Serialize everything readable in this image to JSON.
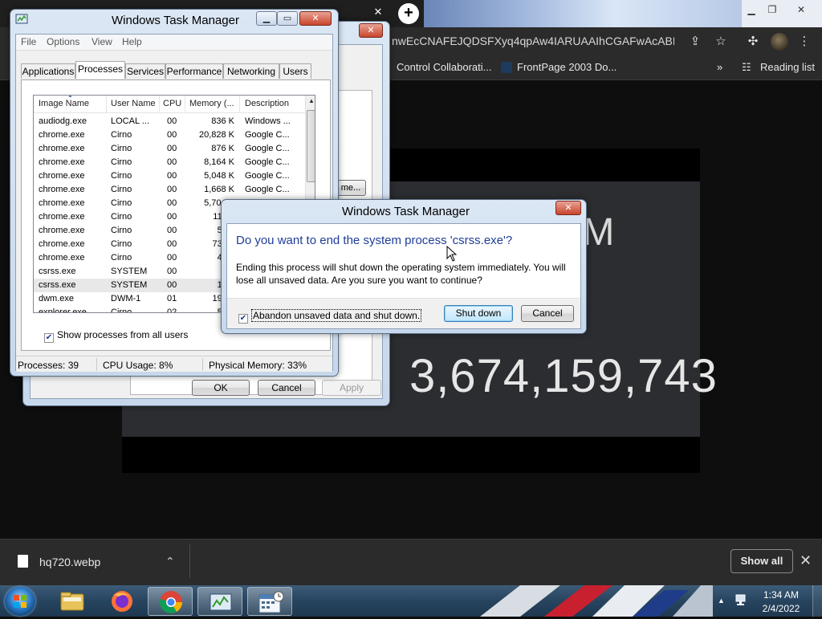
{
  "browser": {
    "url": "nwEcCNAFEJQDSFXyq4qpAw4IARUAAIhCGAFwAcABBg...",
    "bookmarks": [
      {
        "label": "Control Collaborati..."
      },
      {
        "label": "FrontPage 2003 Do..."
      }
    ],
    "reading_list": "Reading list",
    "more_bookmarks": "»"
  },
  "video": {
    "time_text": "5 AM",
    "count_text": "3,674,159,743"
  },
  "properties_dialog": {
    "buttons": {
      "ok": "OK",
      "cancel": "Cancel",
      "apply": "Apply"
    },
    "partial_button": "me..."
  },
  "task_manager": {
    "title": "Windows Task Manager",
    "menu": [
      "File",
      "Options",
      "View",
      "Help"
    ],
    "tabs": [
      "Applications",
      "Processes",
      "Services",
      "Performance",
      "Networking",
      "Users"
    ],
    "active_tab": "Processes",
    "columns": [
      "Image Name",
      "User Name",
      "CPU",
      "Memory (...",
      "Description"
    ],
    "rows": [
      {
        "name": "audiodg.exe",
        "user": "LOCAL ...",
        "cpu": "00",
        "mem": "836 K",
        "desc": "Windows ..."
      },
      {
        "name": "chrome.exe",
        "user": "Cirno",
        "cpu": "00",
        "mem": "20,828 K",
        "desc": "Google C..."
      },
      {
        "name": "chrome.exe",
        "user": "Cirno",
        "cpu": "00",
        "mem": "876 K",
        "desc": "Google C..."
      },
      {
        "name": "chrome.exe",
        "user": "Cirno",
        "cpu": "00",
        "mem": "8,164 K",
        "desc": "Google C..."
      },
      {
        "name": "chrome.exe",
        "user": "Cirno",
        "cpu": "00",
        "mem": "5,048 K",
        "desc": "Google C..."
      },
      {
        "name": "chrome.exe",
        "user": "Cirno",
        "cpu": "00",
        "mem": "1,668 K",
        "desc": "Google C..."
      },
      {
        "name": "chrome.exe",
        "user": "Cirno",
        "cpu": "00",
        "mem": "5,704 K",
        "desc": "Google C..."
      },
      {
        "name": "chrome.exe",
        "user": "Cirno",
        "cpu": "00",
        "mem": "11,97",
        "desc": ""
      },
      {
        "name": "chrome.exe",
        "user": "Cirno",
        "cpu": "00",
        "mem": "5,84",
        "desc": ""
      },
      {
        "name": "chrome.exe",
        "user": "Cirno",
        "cpu": "00",
        "mem": "73,79",
        "desc": ""
      },
      {
        "name": "chrome.exe",
        "user": "Cirno",
        "cpu": "00",
        "mem": "4,68",
        "desc": ""
      },
      {
        "name": "csrss.exe",
        "user": "SYSTEM",
        "cpu": "00",
        "mem": "72",
        "desc": ""
      },
      {
        "name": "csrss.exe",
        "user": "SYSTEM",
        "cpu": "00",
        "mem": "1,00",
        "desc": "",
        "selected": true
      },
      {
        "name": "dwm.exe",
        "user": "DWM-1",
        "cpu": "01",
        "mem": "19,34",
        "desc": ""
      },
      {
        "name": "explorer.exe",
        "user": "Cirno",
        "cpu": "02",
        "mem": "5,89",
        "desc": ""
      }
    ],
    "show_all_label": "Show processes from all users",
    "show_all_checked": true,
    "status": {
      "processes": "Processes: 39",
      "cpu": "CPU Usage: 8%",
      "memory": "Physical Memory: 33%"
    }
  },
  "confirm_dialog": {
    "title": "Windows Task Manager",
    "question": "Do you want to end the system process 'csrss.exe'?",
    "message": "Ending this process will shut down the operating system immediately.  You will lose all unsaved data.  Are you sure you want to continue?",
    "checkbox_label": "Abandon unsaved data and shut down.",
    "checkbox_checked": true,
    "shutdown_label": "Shut down",
    "cancel_label": "Cancel"
  },
  "downloads": {
    "file_name": "hq720.webp",
    "show_all": "Show all"
  },
  "taskbar": {
    "time": "1:34 AM",
    "date": "2/4/2022"
  },
  "colors": {
    "dialog_question": "#1f3d99",
    "browser_dark": "#2b2b2b",
    "taskbar": "#27445f"
  }
}
